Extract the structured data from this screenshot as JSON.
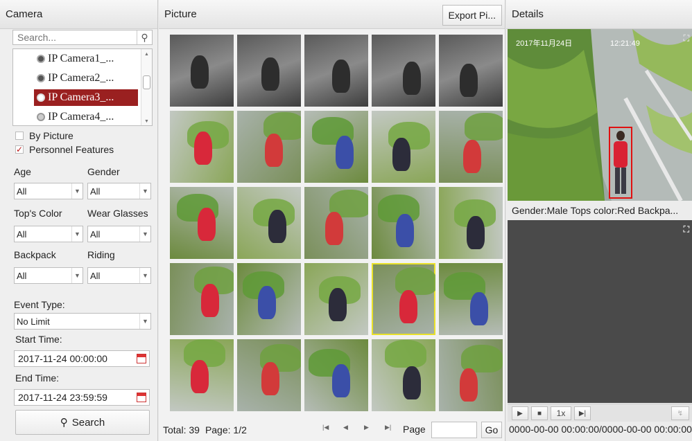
{
  "camera_panel": {
    "title": "Camera",
    "search_placeholder": "Search...",
    "cameras": [
      {
        "label": "IP Camera1_...",
        "selected": false
      },
      {
        "label": "IP Camera2_...",
        "selected": false
      },
      {
        "label": "IP Camera3_...",
        "selected": true
      },
      {
        "label": "IP Camera4_...",
        "selected": false
      }
    ],
    "by_picture_label": "By Picture",
    "personnel_features_label": "Personnel Features",
    "age_label": "Age",
    "gender_label": "Gender",
    "age_value": "All",
    "gender_value": "All",
    "tops_color_label": "Top's Color",
    "wear_glasses_label": "Wear Glasses",
    "tops_color_value": "All",
    "wear_glasses_value": "All",
    "backpack_label": "Backpack",
    "riding_label": "Riding",
    "backpack_value": "All",
    "riding_value": "All",
    "event_type_label": "Event Type:",
    "event_type_value": "No Limit",
    "start_time_label": "Start Time:",
    "start_time_value": "2017-11-24 00:00:00",
    "end_time_label": "End Time:",
    "end_time_value": "2017-11-24 23:59:59",
    "search_button": "Search"
  },
  "picture_panel": {
    "title": "Picture",
    "export_button": "Export Pi...",
    "total_text": "Total: 39",
    "page_text": "Page: 1/2",
    "page_label": "Page",
    "go_button": "Go",
    "thumbnails_count": 25,
    "highlighted_index": 18
  },
  "details_panel": {
    "title": "Details",
    "overlay_date": "2017年11月24日",
    "overlay_time": "12:21:49",
    "caption": "Gender:Male  Tops color:Red  Backpa...",
    "speed_label": "1x",
    "timeline_text": "0000-00-00 00:00:00/0000-00-00 00:00:00"
  },
  "colors": {
    "selected_camera": "#9a2020",
    "highlight_border": "#e9e12a",
    "bounding_box": "#e01010"
  }
}
